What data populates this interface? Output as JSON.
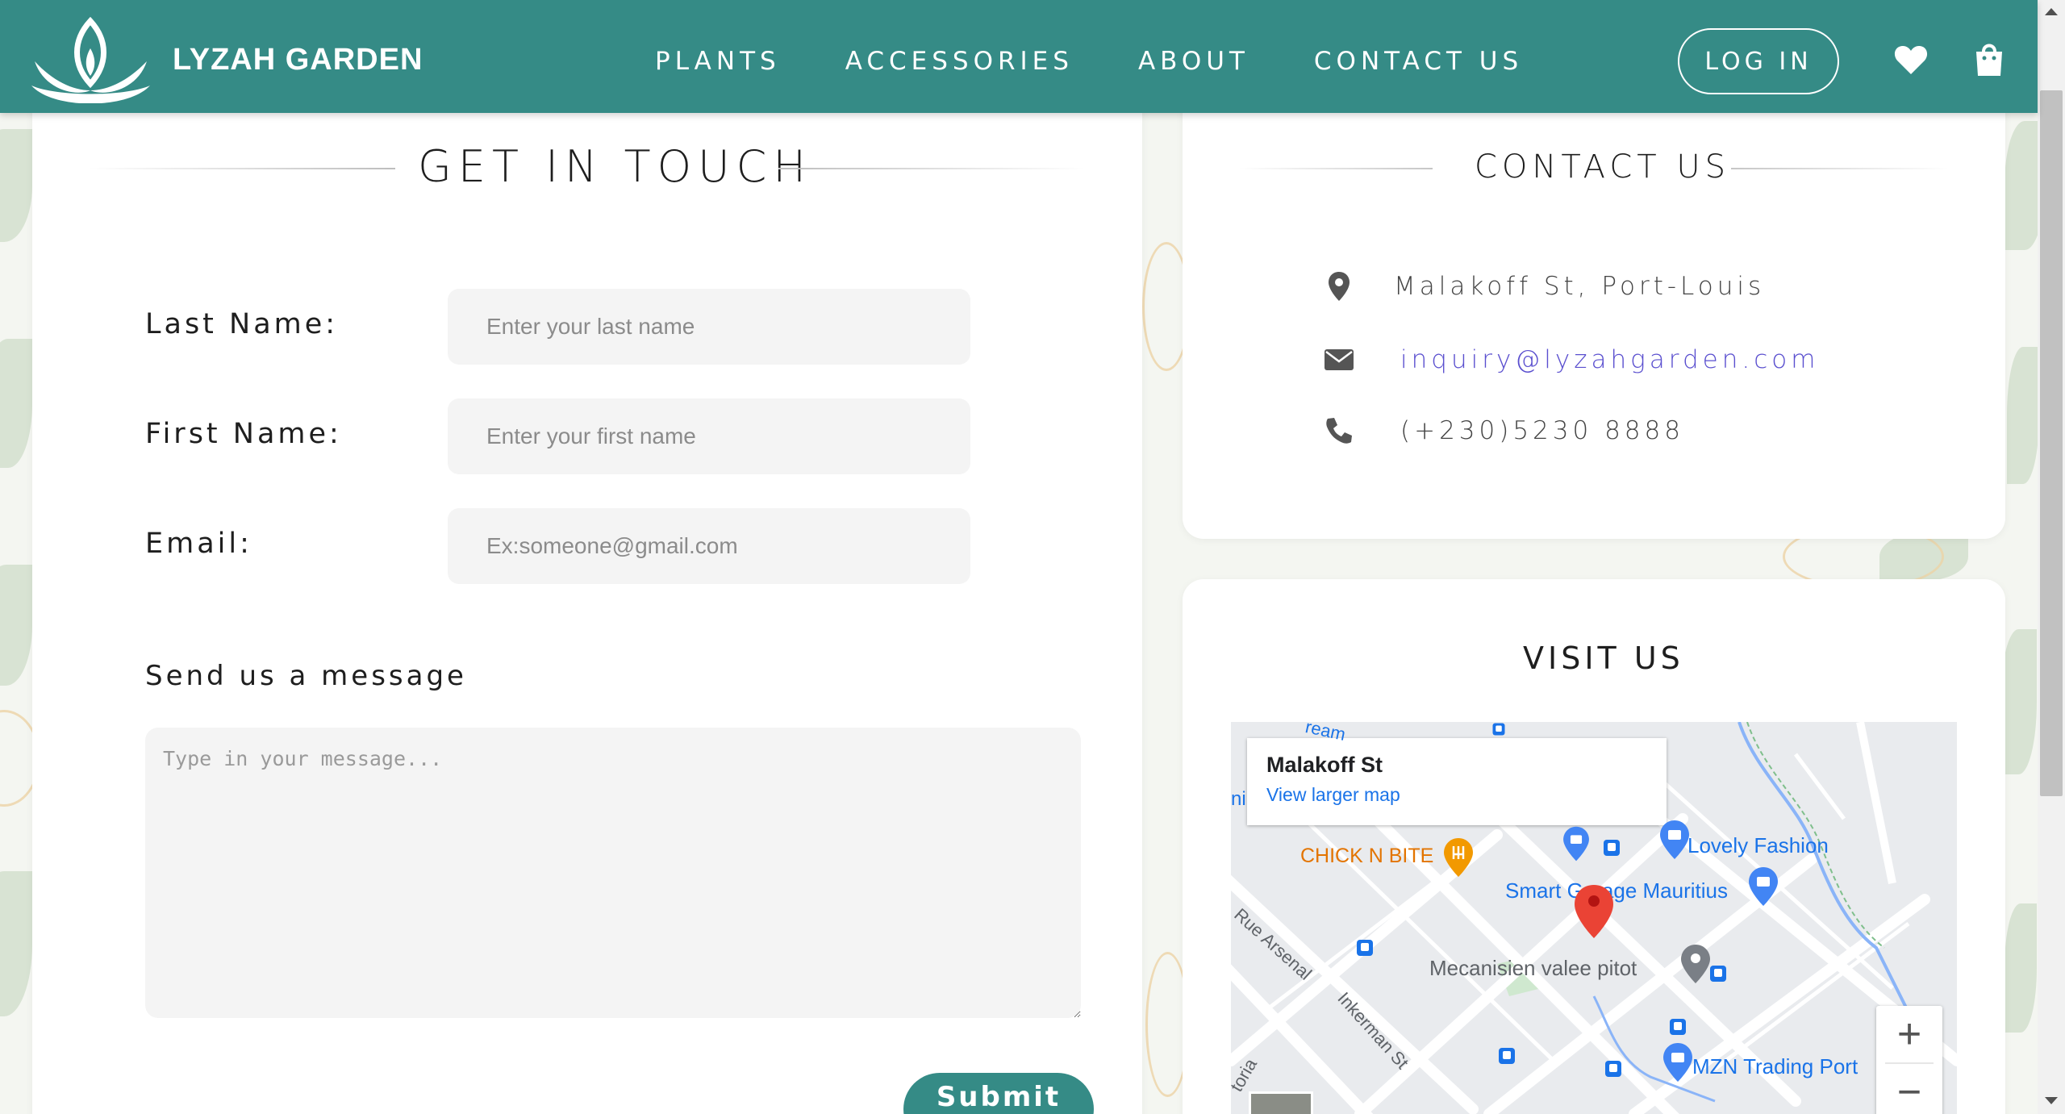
{
  "brand": {
    "name": "LYZAH GARDEN"
  },
  "nav": {
    "items": [
      "PLANTS",
      "ACCESSORIES",
      "ABOUT",
      "CONTACT US"
    ]
  },
  "header": {
    "login_label": "LOG IN",
    "icons": [
      "heart-icon",
      "shopping-bag-icon"
    ]
  },
  "colors": {
    "primary": "#358b86",
    "link": "#5a4fcf",
    "map_link": "#1a73e8"
  },
  "form": {
    "title": "GET IN TOUCH",
    "fields": [
      {
        "label": "Last Name:",
        "placeholder": "Enter your last name",
        "value": ""
      },
      {
        "label": "First Name:",
        "placeholder": "Enter your first name",
        "value": ""
      },
      {
        "label": "Email:",
        "placeholder": "Ex:someone@gmail.com",
        "value": ""
      }
    ],
    "message_label": "Send us a message",
    "message_placeholder": "Type in your message...",
    "submit_label": "Submit"
  },
  "contact": {
    "title": "CONTACT US",
    "address": "Malakoff St, Port-Louis",
    "email": "inquiry@lyzahgarden.com",
    "phone": "(+230)5230 8888",
    "icons": [
      "location-pin-icon",
      "envelope-icon",
      "phone-icon"
    ]
  },
  "visit": {
    "title": "VISIT US",
    "map": {
      "place_name": "Malakoff St",
      "larger_map_link": "View larger map",
      "labels": {
        "chick_n_bite": "CHICK N BITE",
        "lovely_fashion": "Lovely Fashion",
        "smart_garage": "Smart Garage Mauritius",
        "mecanisien": "Mecanisien valee pitot",
        "mzn": "MZN Trading Port",
        "rue_arsenal": "Rue Arsenal",
        "inkerman": "Inkerman St",
        "partial_top": "ream",
        "partial_left": "ni",
        "partial_bottom": "toria"
      },
      "zoom_in": "+",
      "zoom_out": "−"
    }
  }
}
